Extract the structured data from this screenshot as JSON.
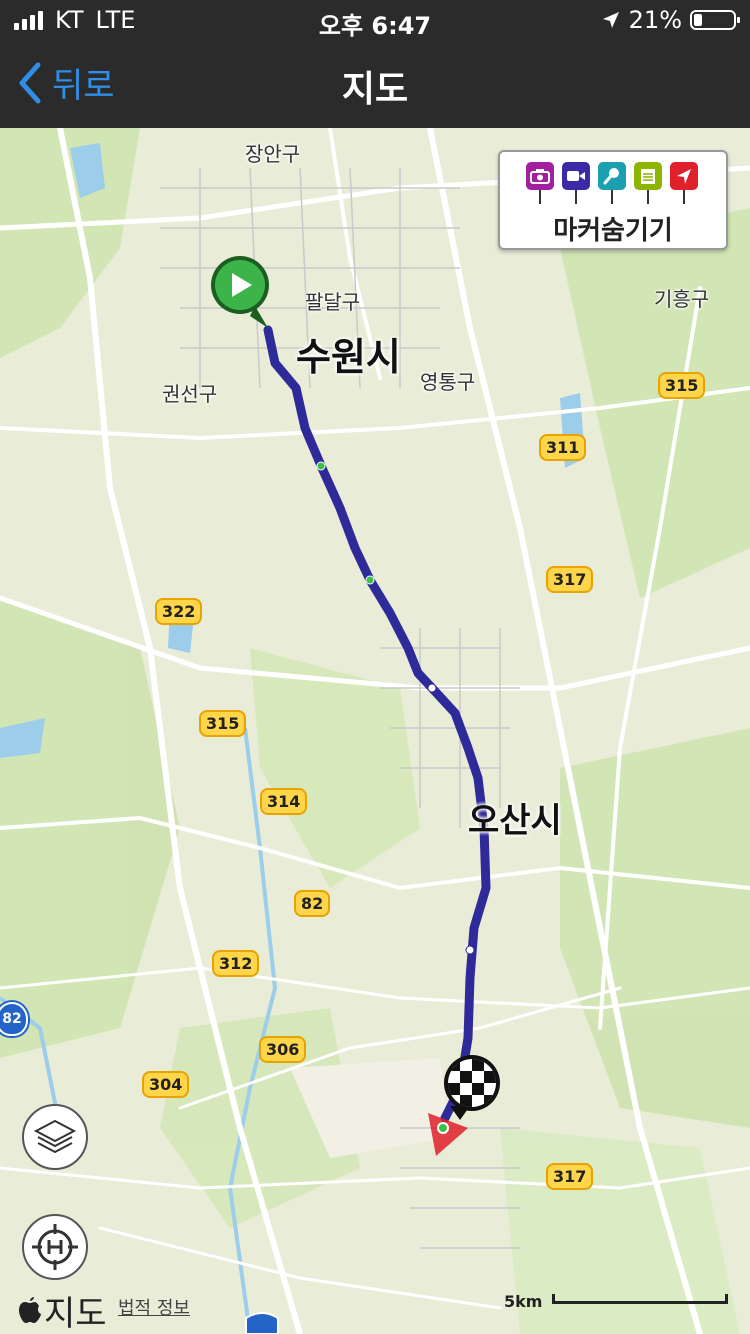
{
  "status_bar": {
    "carrier": "KT",
    "network": "LTE",
    "time": "오후 6:47",
    "battery": "21%"
  },
  "nav": {
    "back_label": "뒤로",
    "title": "지도"
  },
  "map": {
    "place_labels": {
      "jangan": "장안구",
      "paldal": "팔달구",
      "giheung": "기흥구",
      "gwonseon": "권선구",
      "yeongtong": "영통구"
    },
    "city_labels": {
      "suwon": "수원시",
      "osan": "오산시"
    },
    "road_shields": {
      "r315_a": "315",
      "r311": "311",
      "r317_a": "317",
      "r322": "322",
      "r315_b": "315",
      "r314": "314",
      "r82": "82",
      "r312": "312",
      "r306": "306",
      "r304": "304",
      "r317_b": "317",
      "hw82": "82"
    },
    "marker_panel": {
      "label": "마커숨기기",
      "icons": [
        "camera-icon",
        "video-icon",
        "microphone-icon",
        "note-icon",
        "navigation-icon"
      ],
      "colors": [
        "#a020a0",
        "#3a2aa8",
        "#1aa0b0",
        "#8cb400",
        "#e0202a"
      ]
    },
    "route_color": "#2f2a9a",
    "attribution": "지도",
    "legal": "법적 정보",
    "scale_label": "5km"
  }
}
